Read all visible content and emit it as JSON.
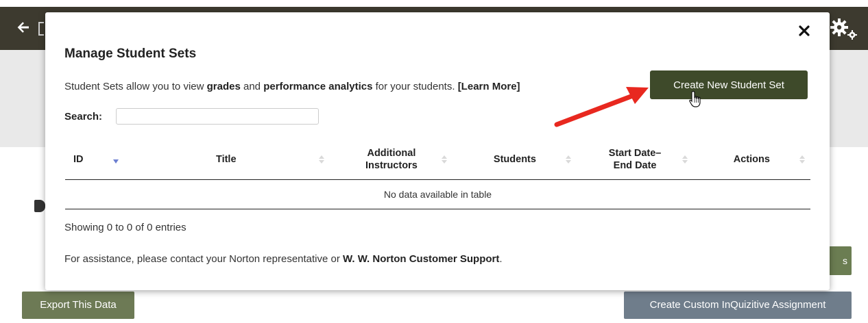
{
  "background": {
    "export_label": "Export This Data",
    "inquizitive_label": "Create Custom InQuizitive Assignment",
    "partial_button_label": "s"
  },
  "modal": {
    "title": "Manage Student Sets",
    "description": {
      "prefix": "Student Sets allow you to view ",
      "grades": "grades",
      "and": " and ",
      "analytics": "performance analytics",
      "suffix": " for your students. ",
      "learn_more": "[Learn More]"
    },
    "create_button_label": "Create New Student Set",
    "search_label": "Search:",
    "search_value": "",
    "table": {
      "headers": [
        "ID",
        "Title",
        "Additional Instructors",
        "Students",
        "Start Date–End Date",
        "Actions"
      ],
      "header_lines": [
        [
          "ID"
        ],
        [
          "Title"
        ],
        [
          "Additional",
          "Instructors"
        ],
        [
          "Students"
        ],
        [
          "Start Date–",
          "End Date"
        ],
        [
          "Actions"
        ]
      ],
      "empty_message": "No data available in table"
    },
    "info_text": "Showing 0 to 0 of 0 entries",
    "assist": {
      "prefix": "For assistance, please contact your Norton representative or ",
      "link": "W. W. Norton Customer Support",
      "suffix": "."
    }
  },
  "colors": {
    "topbar": "#3d3a2f",
    "create_button": "#3e4a2a",
    "export_button": "#6d7a55",
    "inquizitive_button": "#6f7d8b",
    "annotation_arrow": "#e8281f",
    "sort_active": "#6c7fd1"
  },
  "icons": {
    "back": "arrow-left-icon",
    "settings": "gears-icon",
    "close": "close-icon",
    "cursor": "hand-pointer-icon"
  }
}
